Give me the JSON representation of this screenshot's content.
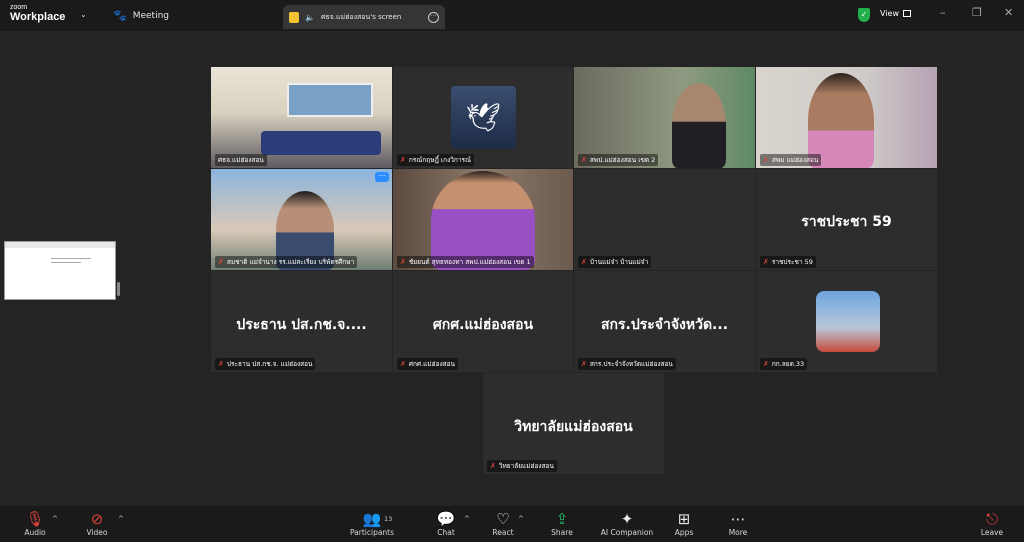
{
  "window": {
    "logo_line1": "zoom",
    "logo_line2": "Workplace",
    "meeting_label": "Meeting"
  },
  "share_tab": {
    "label": "ศธจ.แม่ฮ่องสอน's screen"
  },
  "view_label": "View",
  "colors": {
    "active_border": "#2ecc71",
    "muted_mic": "#e0433b",
    "share_green": "#1ec26b",
    "tile_bg": "#2d2d2d"
  },
  "tiles": [
    {
      "name": "ศธจ.แม่ฮ่องสอน",
      "big": ""
    },
    {
      "name": "กรณ์กฤษฎิ์ เกงวิการณ์",
      "big": ""
    },
    {
      "name": "สพป.แม่ฮ่องสอน เขต 2",
      "big": ""
    },
    {
      "name": "สพม แม่ฮ่องสอน",
      "big": ""
    },
    {
      "name": "สมชาติ แม่จำนาง รร.แม่สะเรียง บริพัตรศึกษา",
      "big": ""
    },
    {
      "name": "ชัยยนต์ สุทธทองทา สพป.แม่ฮ่องสอน เขต 1",
      "big": ""
    },
    {
      "name": "บ้านแม่จ๋า บ้านแม่จ๋า",
      "big": ""
    },
    {
      "name": "ราชประชา 59",
      "big": "ราชประชา 59"
    },
    {
      "name": "ประธาน ปส.กช.จ. แม่ฮ่องสอน",
      "big": "ประธาน ปส.กช.จ...."
    },
    {
      "name": "ศกศ.แม่ฮ่องสอน",
      "big": "ศกศ.แม่ฮ่องสอน"
    },
    {
      "name": "สกร.ประจำจังหวัดแม่ฮ่องสอน",
      "big": "สกร.ประจำจังหวัด..."
    },
    {
      "name": "กก.ลยต.33",
      "big": ""
    },
    {
      "name": "วิทยาลัยแม่ฮ่องสอน",
      "big": "วิทยาลัยแม่ฮ่องสอน"
    }
  ],
  "toolbar": {
    "audio": "Audio",
    "video": "Video",
    "participants": "Participants",
    "participants_count": "13",
    "chat": "Chat",
    "react": "React",
    "share": "Share",
    "ai_companion": "AI Companion",
    "apps": "Apps",
    "more": "More",
    "leave": "Leave"
  },
  "icons": [
    "paw-icon",
    "speaker-icon",
    "more-circle-icon",
    "shield-check-icon",
    "microphone-muted-icon",
    "video-off-icon",
    "participants-icon",
    "chat-icon",
    "react-heart-icon",
    "share-arrow-icon",
    "sparkle-icon",
    "apps-grid-icon",
    "more-dots-icon",
    "leave-icon"
  ]
}
